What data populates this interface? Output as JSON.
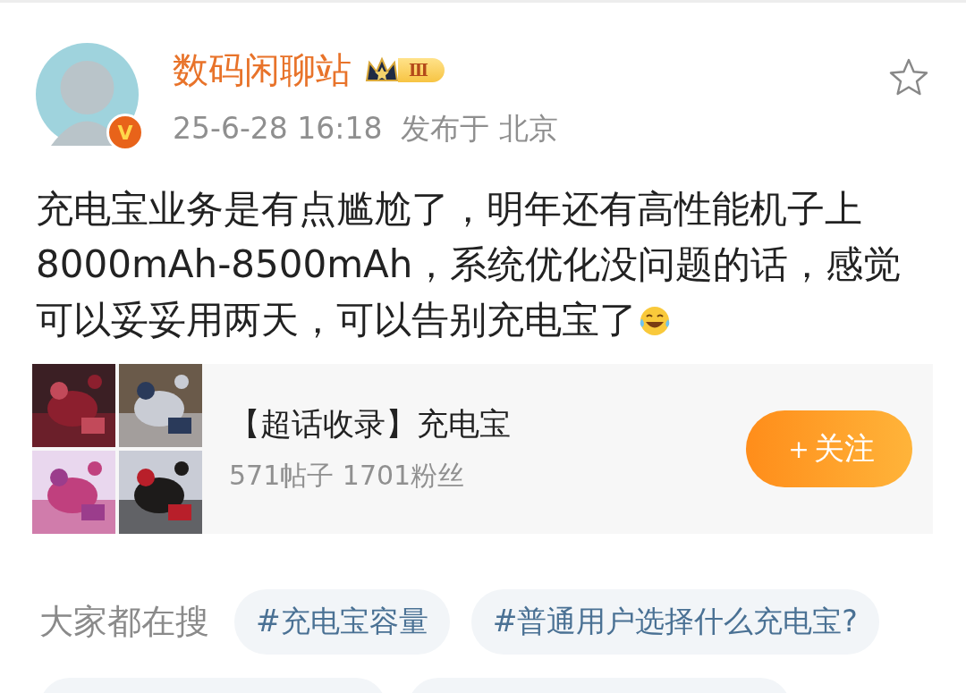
{
  "post": {
    "author": {
      "name": "数码闲聊站",
      "verified_mark": "V",
      "level_badge": "Ⅲ"
    },
    "favorited": false,
    "meta": {
      "time": "25-6-28 16:18",
      "location": "发布于 北京"
    },
    "text": "充电宝业务是有点尴尬了，明年还有高性能机子上8000mAh-8500mAh，系统优化没问题的话，感觉可以妥妥用两天，可以告别充电宝了",
    "trailing_emoji": {
      "kind": "laughing-tears"
    }
  },
  "topic_card": {
    "title": "【超话收录】充电宝",
    "stats": "571帖子 1701粉丝",
    "follow_button": "＋关注"
  },
  "searches": {
    "label": "大家都在搜",
    "tags": [
      {
        "text": "#充电宝容量",
        "kind": "full"
      },
      {
        "text": "#普通用户选择什么充电宝?",
        "kind": "full"
      },
      {
        "kind": "partial"
      },
      {
        "kind": "partial"
      }
    ]
  }
}
